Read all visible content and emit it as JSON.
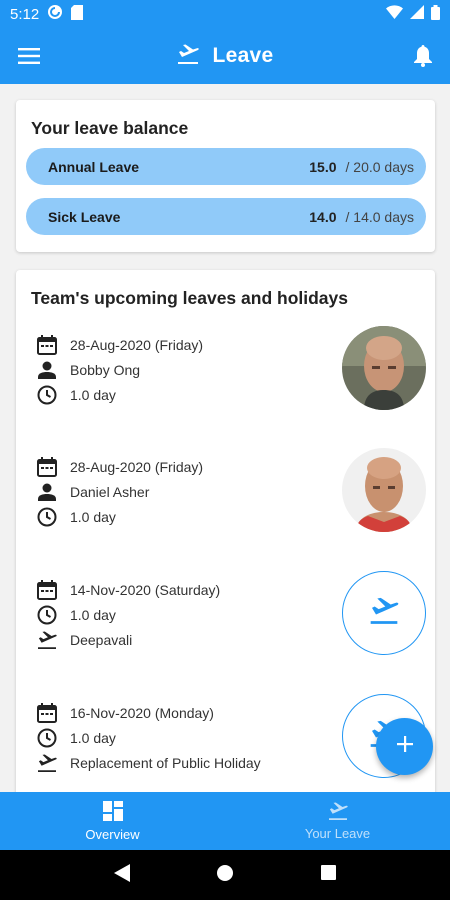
{
  "status_bar": {
    "time": "5:12"
  },
  "app_bar": {
    "title": "Leave"
  },
  "balance": {
    "title": "Your leave balance",
    "items": [
      {
        "name": "Annual Leave",
        "taken": "15.0",
        "total": "/ 20.0 days"
      },
      {
        "name": "Sick Leave",
        "taken": "14.0",
        "total": "/ 14.0 days"
      }
    ]
  },
  "team": {
    "title": "Team's upcoming leaves and holidays",
    "entries": [
      {
        "date": "28-Aug-2020 (Friday)",
        "person": "Bobby Ong",
        "duration": "1.0 day"
      },
      {
        "date": "28-Aug-2020 (Friday)",
        "person": "Daniel Asher",
        "duration": "1.0 day"
      },
      {
        "date": "14-Nov-2020 (Saturday)",
        "duration": "1.0 day",
        "holiday": "Deepavali"
      },
      {
        "date": "16-Nov-2020 (Monday)",
        "duration": "1.0 day",
        "holiday": "Replacement of Public Holiday"
      }
    ]
  },
  "bottom_nav": {
    "overview": "Overview",
    "your_leave": "Your Leave"
  },
  "colors": {
    "primary": "#2196f3",
    "pill": "#90caf9"
  }
}
